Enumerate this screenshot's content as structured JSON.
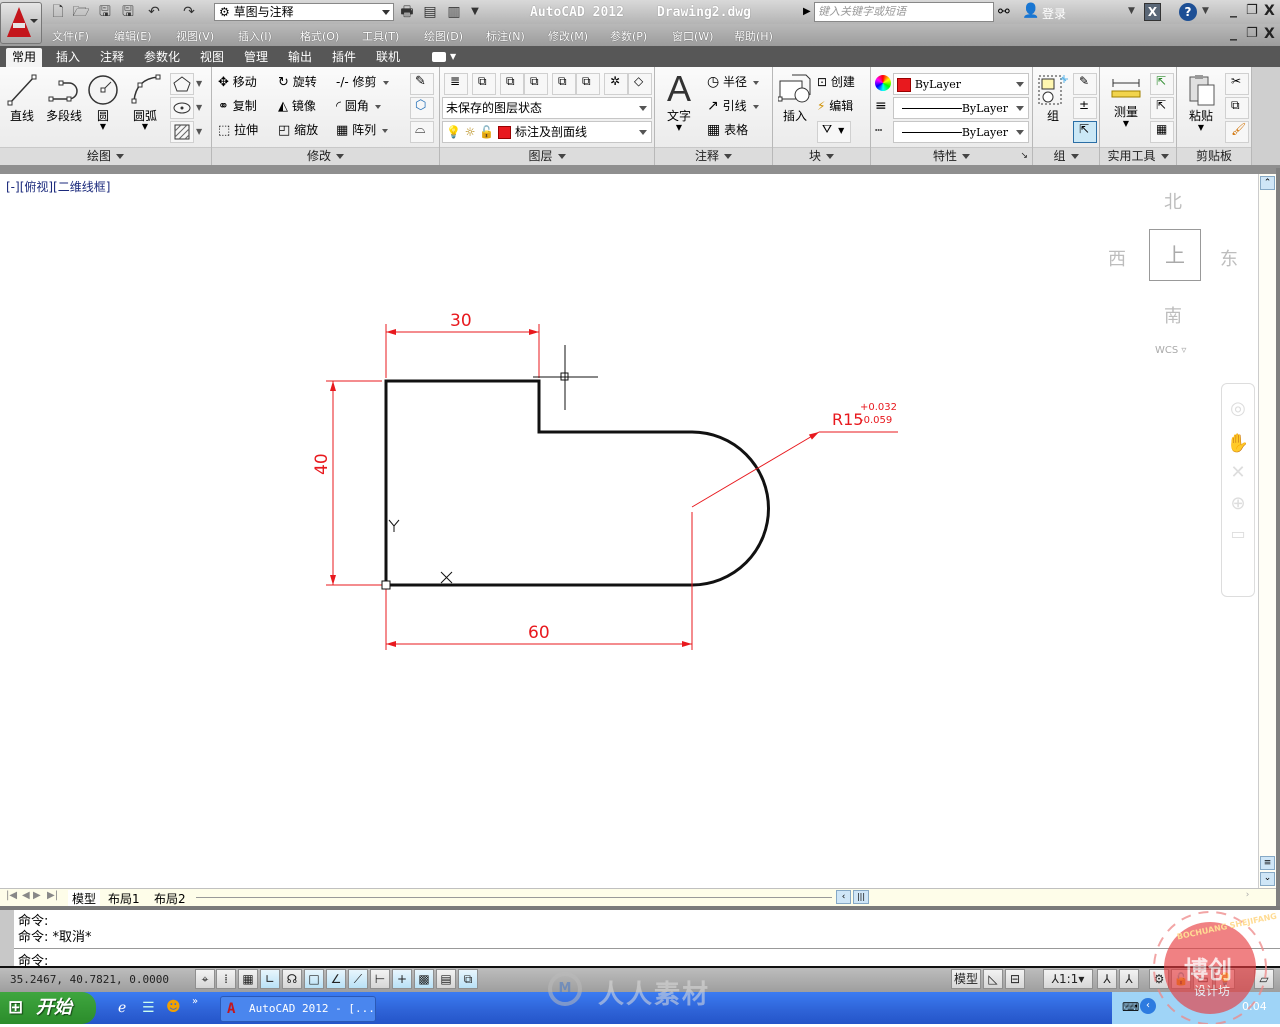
{
  "app": {
    "title": "AutoCAD  2012",
    "document": "Drawing2.dwg",
    "workspace": "草图与注释",
    "search_placeholder": "键入关键字或短语",
    "login_label": "登录"
  },
  "menu": [
    "文件(F)",
    "编辑(E)",
    "视图(V)",
    "插入(I)",
    "格式(O)",
    "工具(T)",
    "绘图(D)",
    "标注(N)",
    "修改(M)",
    "参数(P)",
    "窗口(W)",
    "帮助(H)"
  ],
  "ribbon_tabs": [
    {
      "label": "常用",
      "active": true
    },
    {
      "label": "插入"
    },
    {
      "label": "注释"
    },
    {
      "label": "参数化"
    },
    {
      "label": "视图"
    },
    {
      "label": "管理"
    },
    {
      "label": "输出"
    },
    {
      "label": "插件"
    },
    {
      "label": "联机"
    }
  ],
  "panels": {
    "draw": {
      "title": "绘图",
      "line": "直线",
      "polyline": "多段线",
      "circle": "圆",
      "arc": "圆弧"
    },
    "modify": {
      "title": "修改",
      "move": "移动",
      "rotate": "旋转",
      "trim": "修剪",
      "copy": "复制",
      "mirror": "镜像",
      "fillet": "圆角",
      "stretch": "拉伸",
      "scale": "缩放",
      "array": "阵列"
    },
    "layers": {
      "title": "图层",
      "layer_state": "未保存的图层状态",
      "current_layer": "标注及剖面线",
      "layer_color": "#e8191e"
    },
    "annotation": {
      "title": "注释",
      "text": "文字",
      "radius": "半径",
      "leader": "引线",
      "table": "表格"
    },
    "block": {
      "title": "块",
      "insert": "插入",
      "create": "创建",
      "edit": "编辑"
    },
    "properties": {
      "title": "特性",
      "color": "ByLayer",
      "color_swatch": "#e8191e",
      "lineweight": "ByLayer",
      "linetype": "ByLayer"
    },
    "groups": {
      "title": "组",
      "group": "组"
    },
    "utilities": {
      "title": "实用工具",
      "measure": "测量"
    },
    "clipboard": {
      "title": "剪贴板",
      "paste": "粘贴"
    }
  },
  "viewport": {
    "label": "[-][俯视][二维线框]",
    "viewcube": {
      "north": "北",
      "south": "南",
      "east": "东",
      "west": "西",
      "top": "上",
      "wcs": "WCS"
    }
  },
  "drawing": {
    "dimensions": {
      "top_width": "30",
      "height": "40",
      "bottom_width": "60",
      "radius": "R15",
      "radius_upper_tol": "+0.032",
      "radius_lower_tol": "-0.059"
    },
    "ucs": {
      "x": "X",
      "y": "Y"
    },
    "dim_color": "#e8191e"
  },
  "layout_tabs": [
    "模型",
    "布局1",
    "布局2"
  ],
  "command": {
    "history": [
      "命令:",
      "命令: *取消*"
    ],
    "prompt": "命令:"
  },
  "status": {
    "coordinates": "35.2467, 40.7821, 0.0000",
    "model_label": "模型",
    "annotation_scale": "1:1"
  },
  "taskbar": {
    "start_label": "开始",
    "app_label": "AutoCAD 2012 - [...",
    "clock": "0:04"
  },
  "watermarks": {
    "center": "人人素材",
    "corner_top": "BOCHUANG SHEJIFANG",
    "corner_main": "博创",
    "corner_sub": "设计坊"
  }
}
